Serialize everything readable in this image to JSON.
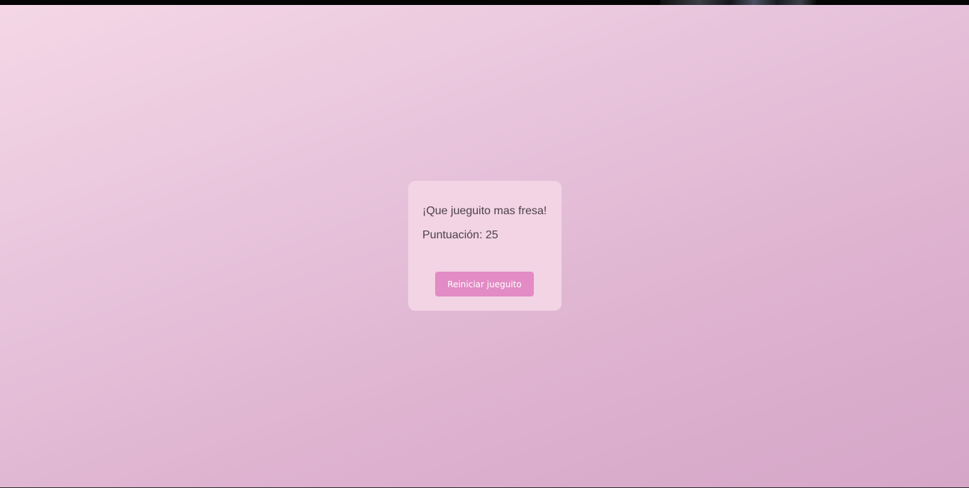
{
  "colors": {
    "background_gradient": [
      "#f4d7e6",
      "#d6a6c8"
    ],
    "card_background": "#f2d4e5",
    "button_background": "#e28bc4",
    "button_text": "#ffffff",
    "text": "#4d4148"
  },
  "result_card": {
    "message": "¡Que jueguito mas fresa!",
    "score_label": "Puntuación:",
    "score_value": "25",
    "restart_label": "Reiniciar jueguito"
  }
}
